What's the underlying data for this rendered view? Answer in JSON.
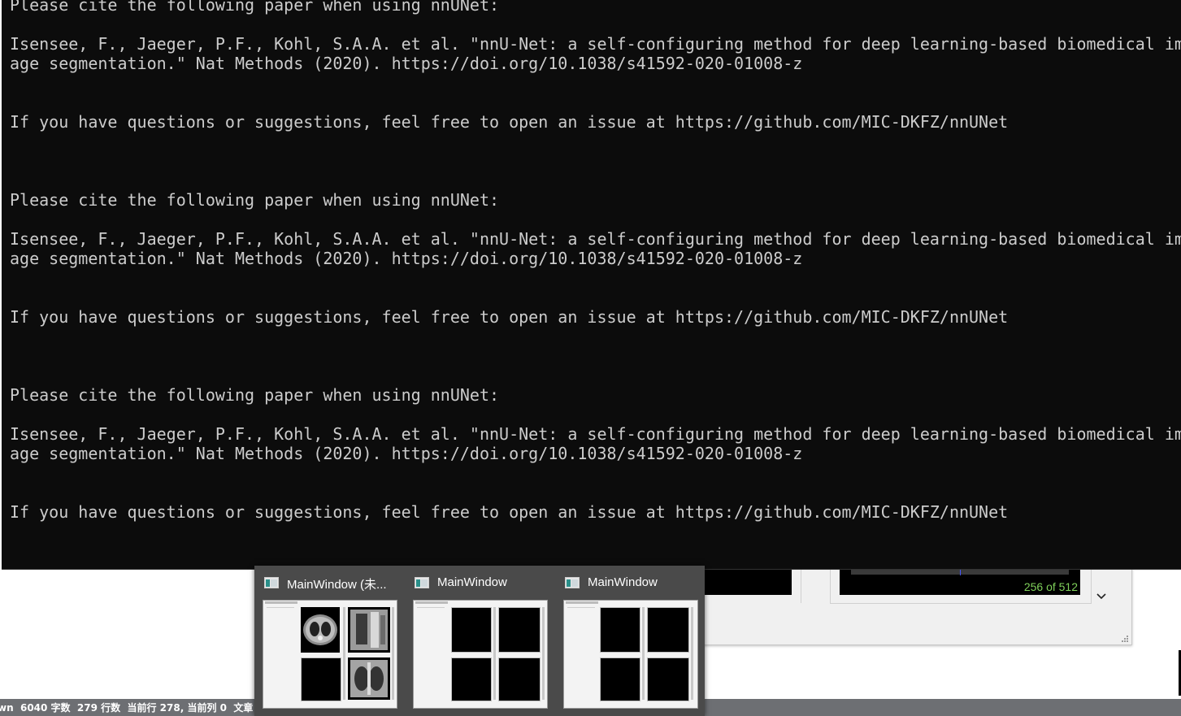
{
  "console": {
    "lines": [
      "Please cite the following paper when using nnUNet:",
      "Isensee, F., Jaeger, P.F., Kohl, S.A.A. et al. \"nnU-Net: a self-configuring method for deep learning-based biomedical im",
      "age segmentation.\" Nat Methods (2020). https://doi.org/10.1038/s41592-020-01008-z",
      "If you have questions or suggestions, feel free to open an issue at https://github.com/MIC-DKFZ/nnUNet"
    ]
  },
  "background_app": {
    "slice_counter": "256 of 512",
    "accent_text_color": "#7fd05a"
  },
  "taskbar": {
    "status_text": "wn  6040 字数  279 行数  当前行 278, 当前列 0  文章"
  },
  "thumbnails": [
    {
      "title": "MainWindow (未...",
      "icon": "app-window-icon",
      "content": "ct-scans"
    },
    {
      "title": "MainWindow",
      "icon": "app-window-icon",
      "content": "empty-panes"
    },
    {
      "title": "MainWindow",
      "icon": "app-window-icon",
      "content": "empty-panes"
    }
  ],
  "colors": {
    "console_bg": "#0c0c0c",
    "console_fg": "#cccccc",
    "popup_bg": "#4a4a4a"
  }
}
